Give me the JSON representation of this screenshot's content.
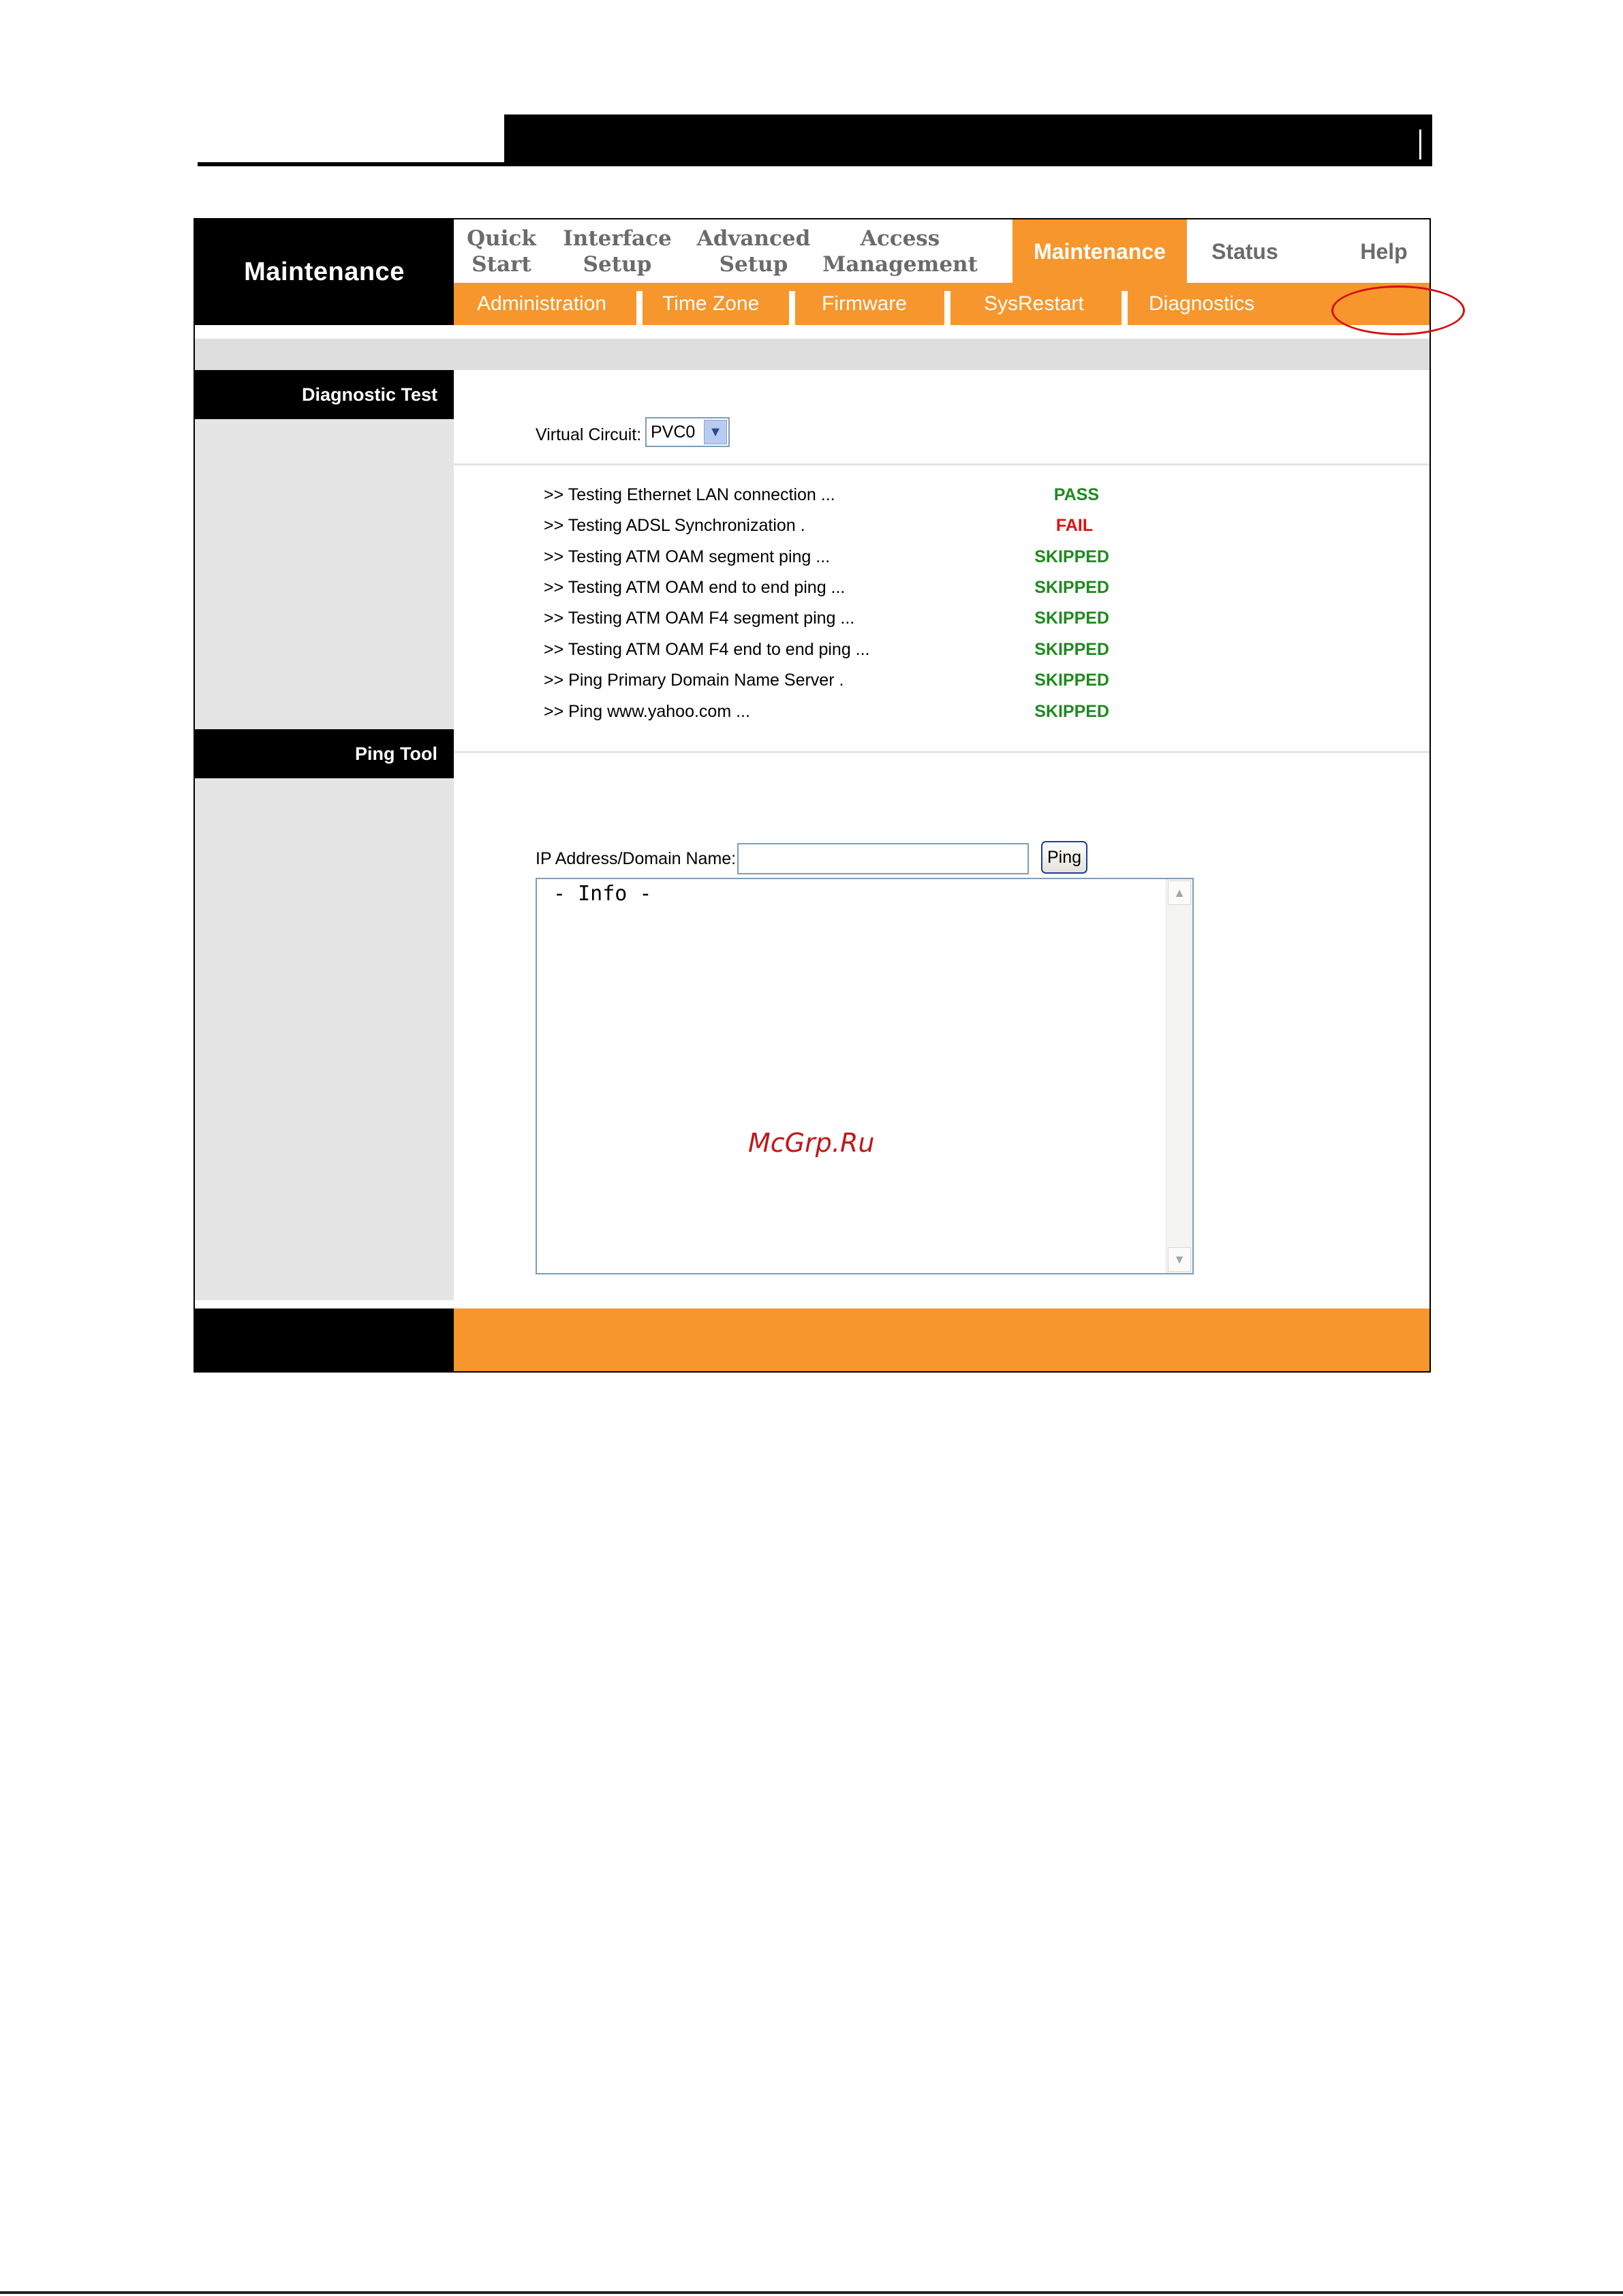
{
  "app": {
    "title": "Maintenance"
  },
  "nav": {
    "items": [
      {
        "label": "Quick\nStart"
      },
      {
        "label": "Interface\nSetup"
      },
      {
        "label": "Advanced\nSetup"
      },
      {
        "label": "Access\nManagement"
      },
      {
        "label": "Maintenance",
        "active": true
      },
      {
        "label": "Status"
      },
      {
        "label": "Help"
      }
    ]
  },
  "subnav": {
    "items": [
      {
        "label": "Administration"
      },
      {
        "label": "Time Zone"
      },
      {
        "label": "Firmware"
      },
      {
        "label": "SysRestart"
      },
      {
        "label": "Diagnostics",
        "active": true
      }
    ]
  },
  "diagnostic": {
    "section_title": "Diagnostic Test",
    "virtual_circuit_label": "Virtual Circuit:",
    "virtual_circuit_value": "PVC0",
    "tests": [
      {
        "label": ">> Testing Ethernet LAN connection ...",
        "status": "PASS"
      },
      {
        "label": ">> Testing ADSL Synchronization .",
        "status": "FAIL"
      },
      {
        "label": ">> Testing ATM OAM segment ping ...",
        "status": "SKIPPED"
      },
      {
        "label": ">> Testing ATM OAM end to end ping ...",
        "status": "SKIPPED"
      },
      {
        "label": ">> Testing ATM OAM F4 segment ping ...",
        "status": "SKIPPED"
      },
      {
        "label": ">> Testing ATM OAM F4 end to end ping ...",
        "status": "SKIPPED"
      },
      {
        "label": ">> Ping Primary Domain Name Server .",
        "status": "SKIPPED"
      },
      {
        "label": ">> Ping www.yahoo.com ...",
        "status": "SKIPPED"
      }
    ]
  },
  "ping": {
    "section_title": "Ping Tool",
    "address_label": "IP Address/Domain Name:",
    "address_value": "",
    "button_label": "Ping",
    "info_text": "- Info -"
  },
  "watermark": "McGrp.Ru",
  "colors": {
    "accent": "#f7962c",
    "pass": "#1e8a1e",
    "fail": "#e01010",
    "skipped": "#1e8a1e",
    "highlight_ring": "#d41010"
  },
  "icons": {
    "select_arrow": "chevron-down-icon",
    "scroll_up": "chevron-up-icon",
    "scroll_down": "chevron-down-icon"
  }
}
